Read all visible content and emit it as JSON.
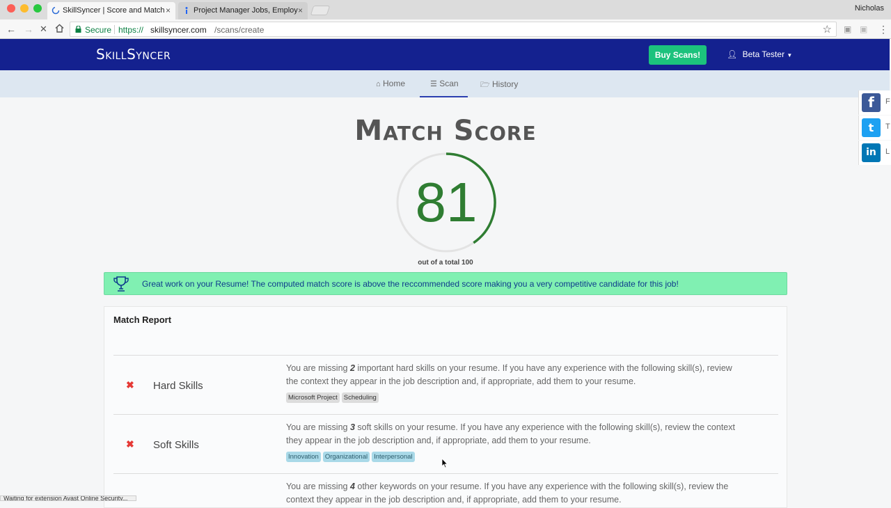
{
  "browser": {
    "tabs": [
      {
        "title": "SkillSyncer | Score and Match",
        "active": true
      },
      {
        "title": "Project Manager Jobs, Employ",
        "active": false
      }
    ],
    "profile_name": "Nicholas",
    "secure_label": "Secure",
    "url_scheme": "https://",
    "url_host": "skillsyncer.com",
    "url_path": "/scans/create",
    "status_text": "Waiting for extension Avast Online Security..."
  },
  "site": {
    "brand": "SkillSyncer",
    "buy_button": "Buy Scans!",
    "user_name": "Beta Tester",
    "subnav": [
      {
        "label": "Home",
        "icon": "home-icon"
      },
      {
        "label": "Scan",
        "icon": "list-icon",
        "active": true
      },
      {
        "label": "History",
        "icon": "folder-icon"
      }
    ]
  },
  "social": [
    {
      "icon": "facebook-icon",
      "glyph": "f",
      "label": "F",
      "color": "#3b5998"
    },
    {
      "icon": "twitter-icon",
      "glyph": "t",
      "label": "T",
      "color": "#1da1f2"
    },
    {
      "icon": "linkedin-icon",
      "glyph": "in",
      "label": "L",
      "color": "#0077b5"
    }
  ],
  "score": {
    "title": "Match Score",
    "value": "81",
    "max": 100,
    "subtitle": "out of a total 100",
    "color": "#2f7d32"
  },
  "alert": {
    "message": "Great work on your Resume! The computed match score is above the reccommended score making you a very competitive candidate for this job!"
  },
  "report": {
    "title": "Match Report",
    "rows": [
      {
        "category": "Hard Skills",
        "desc_prefix": "You are missing ",
        "count": "2",
        "desc_line1_rest": " important hard skills on your resume. If you have any experience with the following skill(s), review",
        "desc_line2": "the context they appear in the job description and, if appropriate, add them to your resume.",
        "tags": [
          "Microsoft Project",
          "Scheduling"
        ],
        "tag_style": "grey"
      },
      {
        "category": "Soft Skills",
        "desc_prefix": "You are missing ",
        "count": "3",
        "desc_line1_rest": " soft skills on your resume. If you have any experience with the following skill(s), review the context",
        "desc_line2": "they appear in the job description and, if appropriate, add them to your resume.",
        "tags": [
          "Innovation",
          "Organizational",
          "Interpersonal"
        ],
        "tag_style": "blue"
      },
      {
        "category": "",
        "desc_prefix": "You are missing ",
        "count": "4",
        "desc_line1_rest": " other keywords on your resume. If you have any experience with the following skill(s), review the",
        "desc_line2": "context they appear in the job description and, if appropriate, add them to your resume.",
        "tags": [],
        "tag_style": "grey"
      }
    ]
  }
}
